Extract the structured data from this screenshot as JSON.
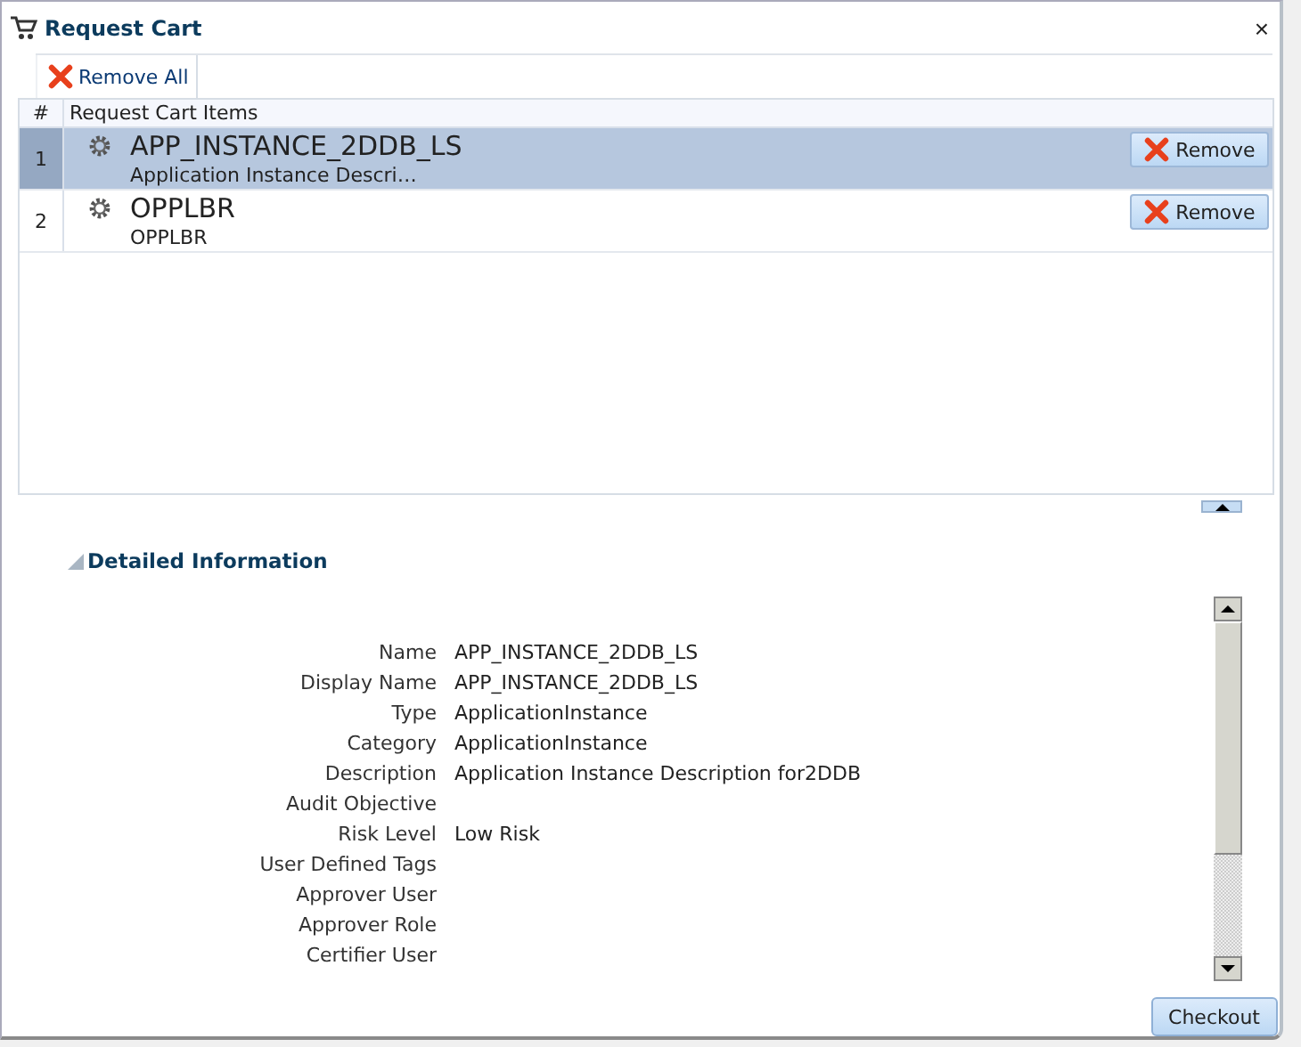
{
  "window": {
    "title": "Request Cart",
    "close": "×"
  },
  "toolbar": {
    "remove_all": "Remove All"
  },
  "table": {
    "columns": [
      "#",
      "Request Cart Items"
    ],
    "rows": [
      {
        "index": "1",
        "name": "APP_INSTANCE_2DDB_LS",
        "description": "Application Instance Descri…",
        "action": "Remove",
        "selected": true
      },
      {
        "index": "2",
        "name": "OPPLBR",
        "description": "OPPLBR",
        "action": "Remove",
        "selected": false
      }
    ]
  },
  "details": {
    "title": "Detailed Information",
    "expanded": true,
    "fields": [
      {
        "label": "Name",
        "value": "APP_INSTANCE_2DDB_LS"
      },
      {
        "label": "Display Name",
        "value": "APP_INSTANCE_2DDB_LS"
      },
      {
        "label": "Type",
        "value": "ApplicationInstance"
      },
      {
        "label": "Category",
        "value": "ApplicationInstance"
      },
      {
        "label": "Description",
        "value": "Application Instance Description for2DDB"
      },
      {
        "label": "Audit Objective"
      },
      {
        "label": "Risk Level",
        "value": "Low Risk"
      },
      {
        "label": "User Defined Tags"
      },
      {
        "label": "Approver User"
      },
      {
        "label": "Approver Role"
      },
      {
        "label": "Certifier User"
      }
    ]
  },
  "buttons": [
    "Checkout"
  ]
}
